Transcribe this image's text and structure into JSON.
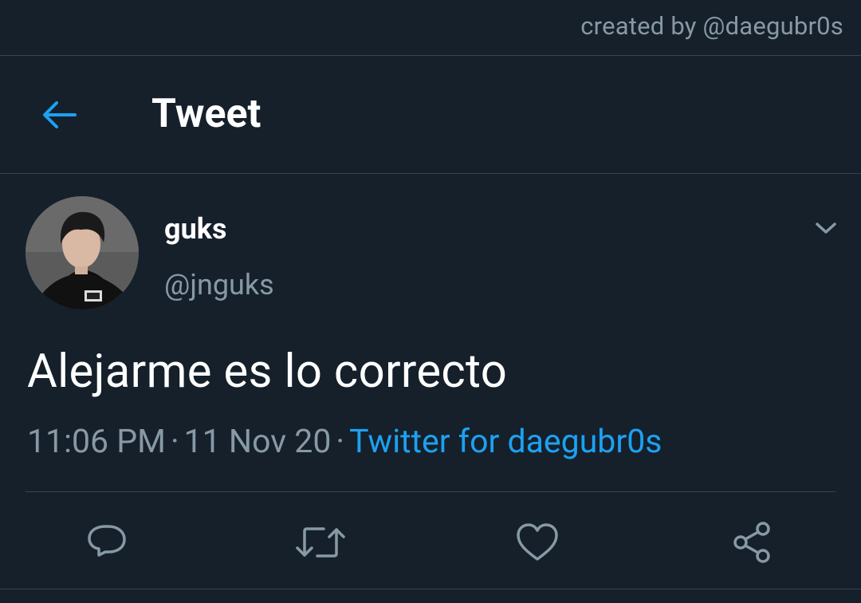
{
  "watermark": {
    "text": "created by @daegubr0s"
  },
  "header": {
    "title": "Tweet",
    "back_icon": "back-arrow-icon"
  },
  "colors": {
    "background": "#15202b",
    "accent": "#1da1f2",
    "muted": "#8899a6",
    "divider": "#38444d"
  },
  "tweet": {
    "author": {
      "display_name": "guks",
      "handle": "@jnguks"
    },
    "text": "Alejarme es lo correcto",
    "time": "11:06 PM",
    "separator": "·",
    "date": "11 Nov 20",
    "source": "Twitter for daegubr0s"
  },
  "actions": [
    {
      "icon": "reply-icon"
    },
    {
      "icon": "retweet-icon"
    },
    {
      "icon": "like-icon"
    },
    {
      "icon": "share-icon"
    }
  ]
}
